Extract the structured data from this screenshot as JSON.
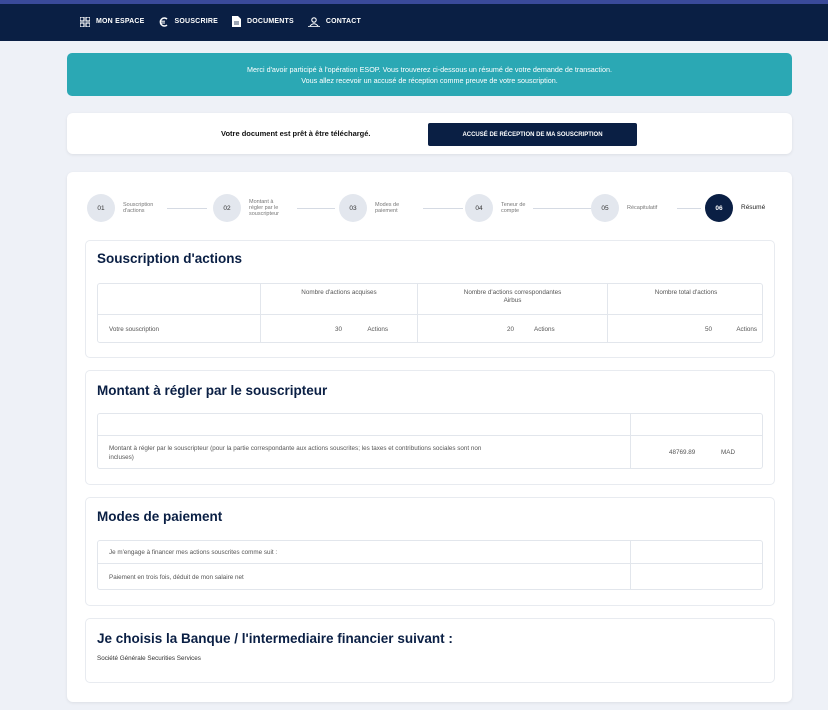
{
  "nav": {
    "items": [
      {
        "label": "MON ESPACE",
        "icon": "grid-icon"
      },
      {
        "label": "SOUSCRIRE",
        "icon": "euro-icon"
      },
      {
        "label": "DOCUMENTS",
        "icon": "document-icon"
      },
      {
        "label": "CONTACT",
        "icon": "people-icon"
      }
    ]
  },
  "banner": {
    "line1": "Merci d'avoir participé à l'opération ESOP. Vous trouverez ci-dessous un résumé de votre demande de transaction.",
    "line2": "Vous allez recevoir un accusé de réception comme preuve de votre souscription."
  },
  "download": {
    "text": "Votre document est prêt à être téléchargé.",
    "button": "ACCUSÉ DE RÉCEPTION DE MA SOUSCRIPTION"
  },
  "steps": [
    {
      "num": "01",
      "label": [
        "Souscription",
        "d'actions"
      ]
    },
    {
      "num": "02",
      "label": [
        "Montant à",
        "régler par le",
        "souscripteur"
      ]
    },
    {
      "num": "03",
      "label": [
        "Modes de",
        "paiement"
      ]
    },
    {
      "num": "04",
      "label": [
        "Teneur de",
        "compte"
      ]
    },
    {
      "num": "05",
      "label": [
        "Récapitulatif"
      ]
    },
    {
      "num": "06",
      "label": [
        "Résumé"
      ]
    }
  ],
  "souscription": {
    "title": "Souscription d'actions",
    "headers": [
      "Nombre d'actions acquises",
      "Nombre d'actions correspondantes",
      "Airbus",
      "Nombre total d'actions"
    ],
    "row_label": "Votre souscription",
    "acquises_value": "30",
    "acquises_unit": "Actions",
    "correspondantes_value": "20",
    "correspondantes_unit": "Actions",
    "total_value": "50",
    "total_unit": "Actions"
  },
  "montant": {
    "title": "Montant à régler par le souscripteur",
    "label_line1": "Montant à régler par le souscripteur (pour la partie correspondante aux actions souscrites; les taxes et contributions sociales sont non",
    "label_line2": "incluses)",
    "value": "48769.89",
    "currency": "MAD"
  },
  "paiement": {
    "title": "Modes de paiement",
    "row1": "Je m'engage à financer mes actions souscrites comme suit :",
    "row2": "Paiement en trois fois, déduit de mon salaire net"
  },
  "banque": {
    "title": "Je choisis la Banque / l'intermediaire financier suivant :",
    "value": "Société Générale Securities Services"
  }
}
